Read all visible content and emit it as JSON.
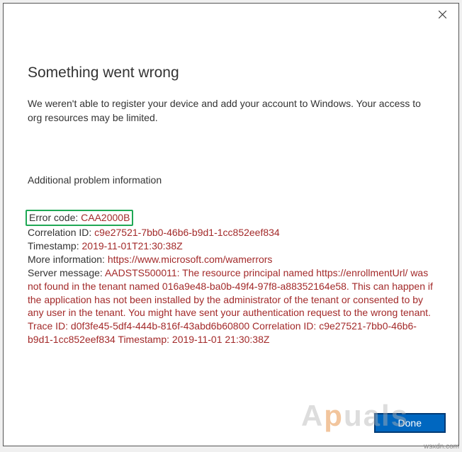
{
  "dialog": {
    "title": "Something went wrong",
    "description": "We weren't able to register your device and add your account to Windows. Your access to org resources may be limited.",
    "additionalHeading": "Additional problem information",
    "errorCodeLabel": "Error code:",
    "errorCode": "CAA2000B",
    "correlationIdLabel": "Correlation ID:",
    "correlationId": "c9e27521-7bb0-46b6-b9d1-1cc852eef834",
    "timestampLabel": "Timestamp:",
    "timestamp": "2019-11-01T21:30:38Z",
    "moreInfoLabel": "More information:",
    "moreInfoUrl": "https://www.microsoft.com/wamerrors",
    "serverMessageLabel": "Server message:",
    "serverMessage": "AADSTS500011: The resource principal named https://enrollmentUrl/ was not found in the tenant named 016a9e48-ba0b-49f4-97f8-a88352164e58. This can happen if the application has not been installed by the administrator of the tenant or consented to by any user in the tenant. You might have sent your authentication request to the wrong tenant. Trace ID: d0f3fe45-5df4-444b-816f-43abd6b60800 Correlation ID: c9e27521-7bb0-46b6-b9d1-1cc852eef834 Timestamp: 2019-11-01 21:30:38Z",
    "doneButton": "Done"
  },
  "watermark": {
    "part1": "A",
    "part2": "p",
    "part3": "uals"
  },
  "credit": "wsxdn.com"
}
